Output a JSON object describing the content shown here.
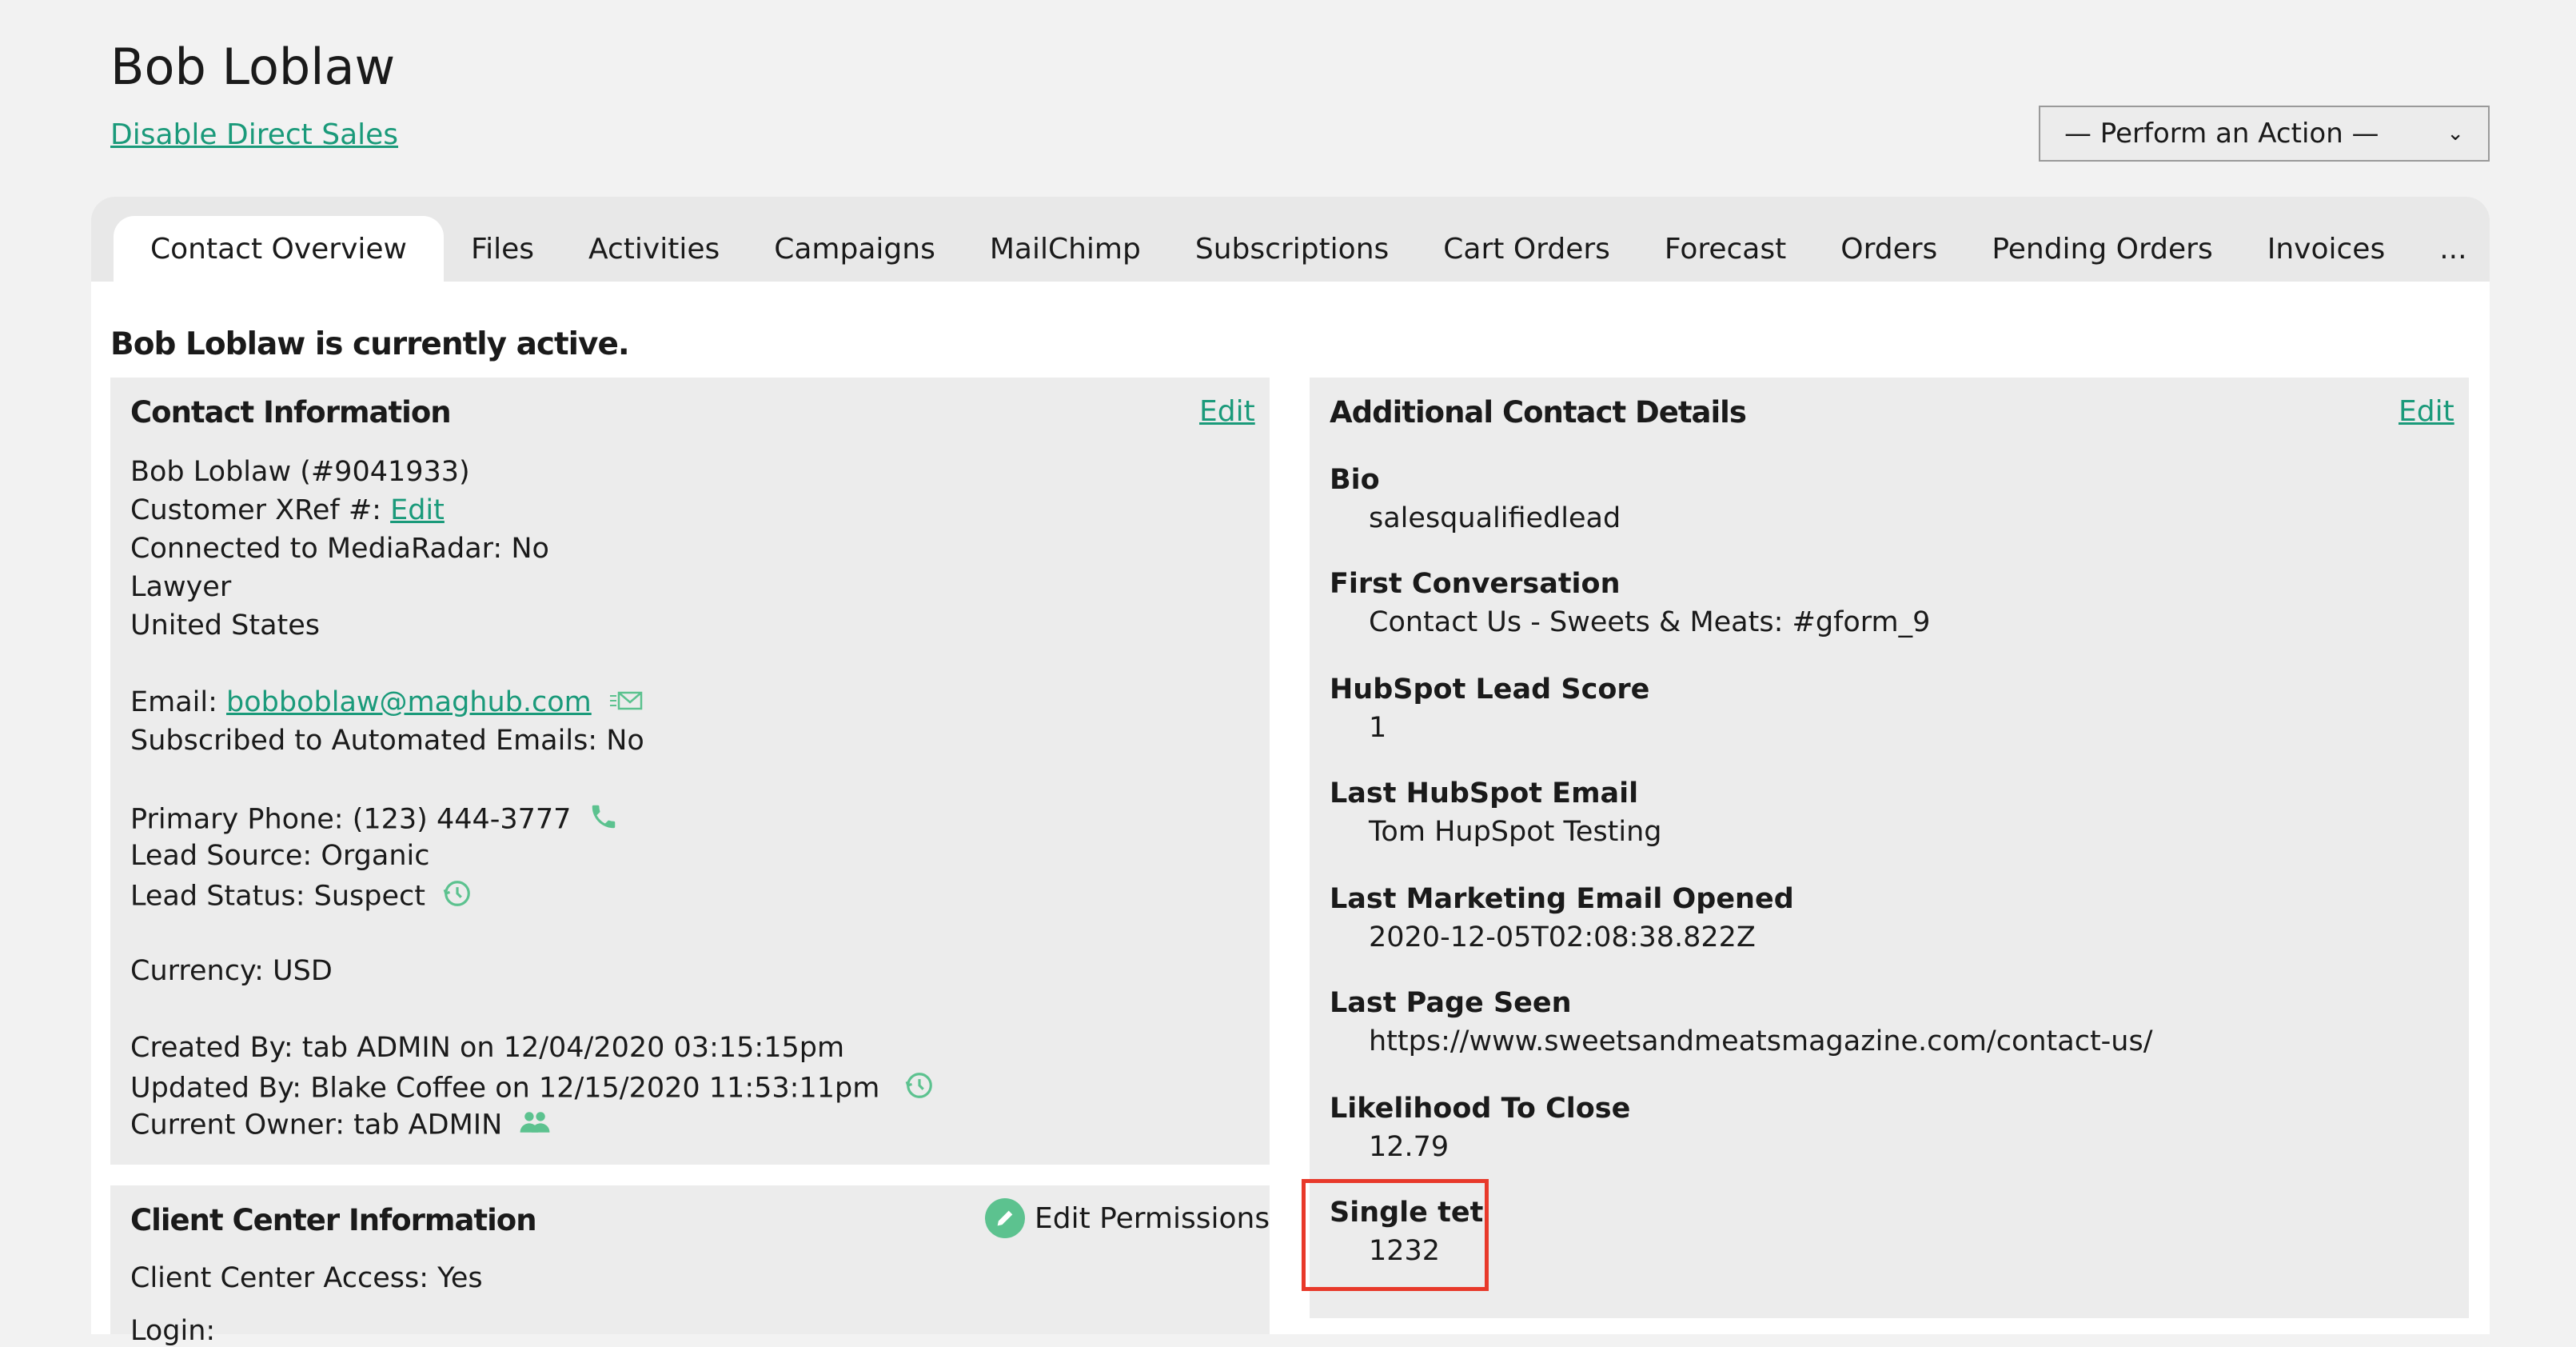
{
  "header": {
    "title": "Bob Loblaw",
    "disable_link": "Disable Direct Sales",
    "action_select": "— Perform an Action —"
  },
  "tabs": [
    {
      "label": "Contact Overview",
      "active": true
    },
    {
      "label": "Files"
    },
    {
      "label": "Activities"
    },
    {
      "label": "Campaigns"
    },
    {
      "label": "MailChimp"
    },
    {
      "label": "Subscriptions"
    },
    {
      "label": "Cart Orders"
    },
    {
      "label": "Forecast"
    },
    {
      "label": "Orders"
    },
    {
      "label": "Pending Orders"
    },
    {
      "label": "Invoices"
    },
    {
      "label": "..."
    }
  ],
  "status": "Bob Loblaw is currently active.",
  "contact_info": {
    "title": "Contact Information",
    "edit": "Edit",
    "name_line": "Bob Loblaw (#9041933)",
    "xref_label": "Customer XRef #: ",
    "xref_edit": "Edit",
    "mediaradar": "Connected to MediaRadar: No",
    "job": "Lawyer",
    "country": "United States",
    "email_label": "Email: ",
    "email": "bobboblaw@maghub.com",
    "subscribed": "Subscribed to Automated Emails: No",
    "phone": "Primary Phone: (123) 444-3777",
    "lead_source": "Lead Source: Organic",
    "lead_status": "Lead Status: Suspect",
    "currency": "Currency: USD",
    "created": "Created By: tab ADMIN on 12/04/2020 03:15:15pm",
    "updated": "Updated By: Blake Coffee on 12/15/2020 11:53:11pm",
    "owner": "Current Owner: tab ADMIN"
  },
  "client_center": {
    "title": "Client Center Information",
    "edit_permissions": "Edit Permissions",
    "access": "Client Center Access: Yes",
    "login": "Login:"
  },
  "additional": {
    "title": "Additional Contact Details",
    "edit": "Edit",
    "fields": [
      {
        "label": "Bio",
        "value": "salesqualifiedlead"
      },
      {
        "label": "First Conversation",
        "value": "Contact Us - Sweets & Meats: #gform_9"
      },
      {
        "label": "HubSpot Lead Score",
        "value": "1"
      },
      {
        "label": "Last HubSpot Email",
        "value": "Tom HupSpot Testing"
      },
      {
        "label": "Last Marketing Email Opened",
        "value": "2020-12-05T02:08:38.822Z"
      },
      {
        "label": "Last Page Seen",
        "value": "https://www.sweetsandmeatsmagazine.com/contact-us/"
      },
      {
        "label": "Likelihood To Close",
        "value": "12.79"
      },
      {
        "label": "Single tet",
        "value": "1232"
      }
    ]
  },
  "colors": {
    "accent": "#1a9a7a",
    "icon_green": "#5cc28f",
    "highlight": "#e8392a"
  }
}
